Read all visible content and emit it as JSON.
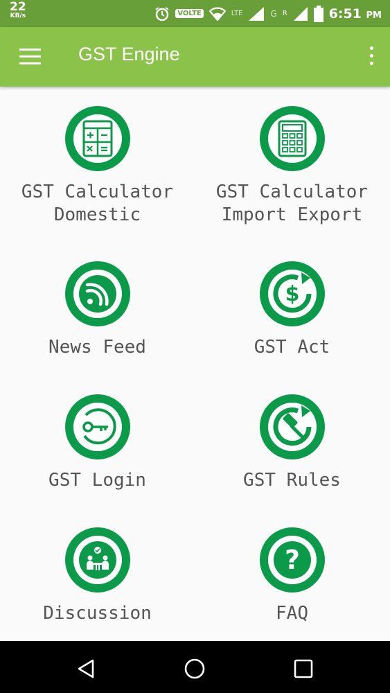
{
  "status_bar": {
    "speed_value": "22",
    "speed_unit": "KB/s",
    "volte": "VOLTE",
    "network_lte": "LTE",
    "network_g": "G",
    "network_r": "R",
    "time": "6:51",
    "ampm": "PM"
  },
  "app_bar": {
    "title": "GST Engine"
  },
  "tiles": [
    {
      "label": "GST Calculator\nDomestic",
      "icon": "calculator-icon"
    },
    {
      "label": "GST Calculator\nImport Export",
      "icon": "calculator-grid-icon"
    },
    {
      "label": "News Feed",
      "icon": "rss-icon"
    },
    {
      "label": "GST Act",
      "icon": "dollar-refresh-icon"
    },
    {
      "label": "GST Login",
      "icon": "key-icon"
    },
    {
      "label": "GST Rules",
      "icon": "gavel-icon"
    },
    {
      "label": "Discussion",
      "icon": "discussion-icon"
    },
    {
      "label": "FAQ",
      "icon": "question-icon"
    }
  ],
  "colors": {
    "status_bar": "#689f38",
    "app_bar": "#8bc34a",
    "icon_green": "#0a9a4a",
    "label_text": "#555555",
    "background": "#fafafa"
  }
}
